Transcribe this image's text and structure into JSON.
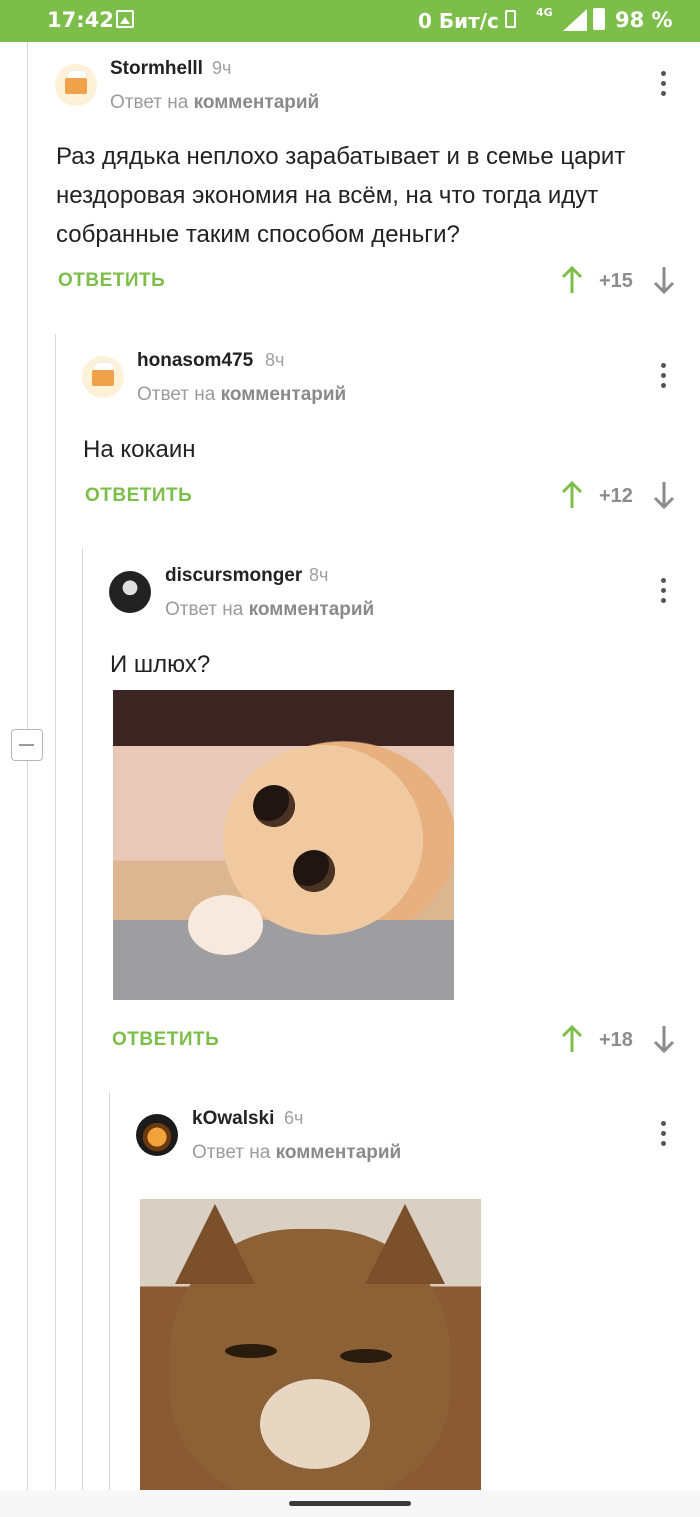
{
  "status_bar": {
    "time": "17:42",
    "network_speed": "0 Бит/с",
    "network_type": "4G",
    "battery": "98 %",
    "icons": [
      "image-icon",
      "vibrate-icon",
      "signal-icon",
      "battery-icon"
    ]
  },
  "colors": {
    "accent": "#7dbd4a",
    "text": "#222222",
    "muted": "#9b9b9b"
  },
  "comments": [
    {
      "username": "Stormhelll",
      "time": "9ч",
      "reply_prefix": "Ответ на",
      "reply_target": "комментарий",
      "text": "Раз дядька неплохо зарабатывает и в семье царит нездоровая экономия на всём, на что тогда идут собранные таким способом деньги?",
      "reply_label": "ОТВЕТИТЬ",
      "score": "+15"
    },
    {
      "username": "honasom475",
      "time": "8ч",
      "reply_prefix": "Ответ на",
      "reply_target": "комментарий",
      "text": "На кокаин",
      "reply_label": "ОТВЕТИТЬ",
      "score": "+12"
    },
    {
      "username": "discursmonger",
      "time": "8ч",
      "reply_prefix": "Ответ на",
      "reply_target": "комментарий",
      "text": "И шлюх?",
      "reply_label": "ОТВЕТИТЬ",
      "score": "+18"
    },
    {
      "username": "kOwalski",
      "time": "6ч",
      "reply_prefix": "Ответ на",
      "reply_target": "комментарий"
    }
  ]
}
